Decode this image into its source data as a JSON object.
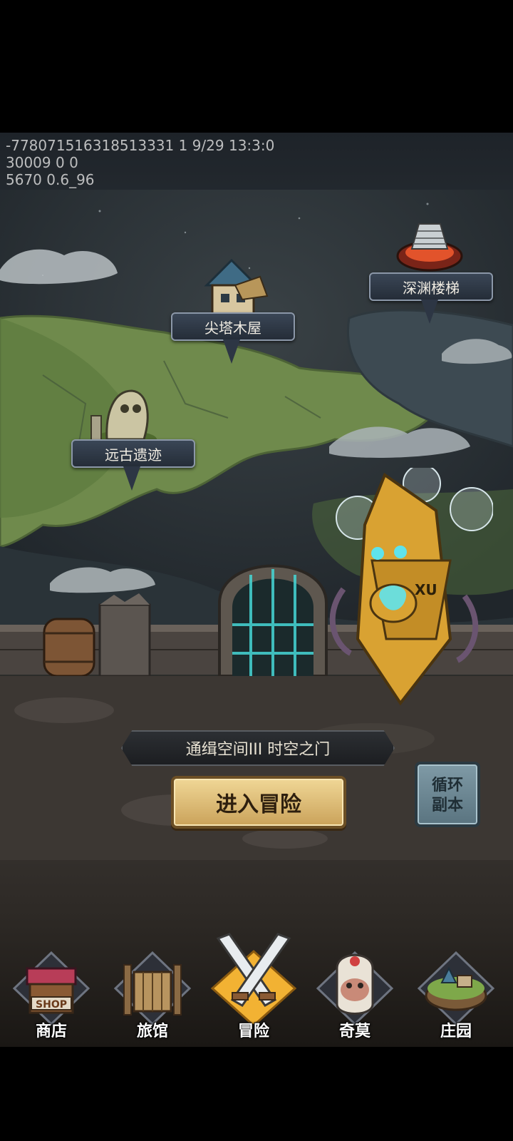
{
  "debug": {
    "line1": "-778071516318513331 1 9/29 13:3:0",
    "line2": "30009 0 0",
    "line3": "5670 0.6_96"
  },
  "map": {
    "locations": [
      {
        "label": "尖塔木屋"
      },
      {
        "label": "深渊楼梯"
      },
      {
        "label": "远古遗迹"
      }
    ]
  },
  "stage": {
    "current_stage": "通缉空间III 时空之门",
    "enter_button": "进入冒险",
    "loop_button_line1": "循环",
    "loop_button_line2": "副本",
    "boss_badge": "XU"
  },
  "nav": {
    "items": [
      {
        "label": "商店",
        "icon": "shop-icon",
        "sign": "SHOP"
      },
      {
        "label": "旅馆",
        "icon": "inn-gate-icon"
      },
      {
        "label": "冒险",
        "icon": "crossed-swords-icon",
        "active": true
      },
      {
        "label": "奇莫",
        "icon": "creature-icon"
      },
      {
        "label": "庄园",
        "icon": "island-icon"
      }
    ]
  },
  "colors": {
    "accent_gold": "#caa25a",
    "banner_blue": "#3a4656",
    "land_green": "#6f8a4c",
    "portal_cyan": "#46d6d6"
  }
}
